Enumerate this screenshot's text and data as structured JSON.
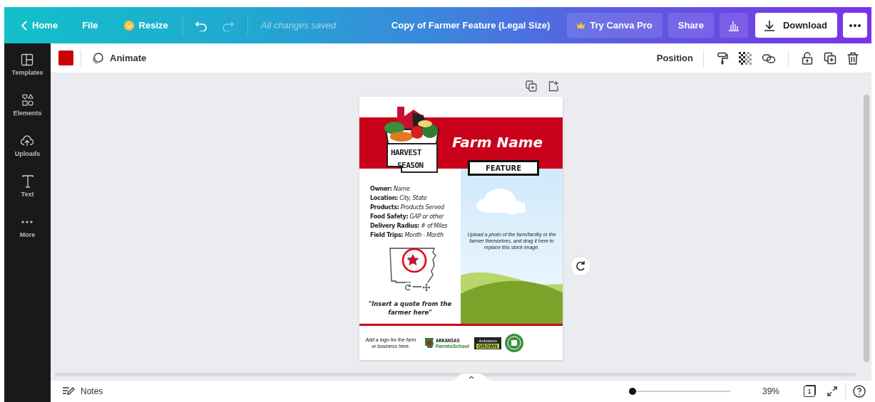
{
  "topbar": {
    "home": "Home",
    "file": "File",
    "resize": "Resize",
    "save_status": "All changes saved",
    "title": "Copy of Farmer Feature (Legal Size)",
    "pro": "Try Canva Pro",
    "share": "Share",
    "download": "Download"
  },
  "toolbar": {
    "color": "#cc0000",
    "animate": "Animate",
    "position": "Position"
  },
  "sidebar": [
    {
      "kind": "templates",
      "label": "Templates"
    },
    {
      "kind": "elements",
      "label": "Elements"
    },
    {
      "kind": "uploads",
      "label": "Uploads"
    },
    {
      "kind": "text",
      "label": "Text"
    },
    {
      "kind": "more",
      "label": "More"
    }
  ],
  "poster": {
    "farm_name": "Farm Name",
    "badge": "FEATURE",
    "logo": {
      "top": "HARVEST",
      "bottom": "SEASON"
    },
    "fields": [
      {
        "label": "Owner:",
        "value": "Name"
      },
      {
        "label": "Location:",
        "value": "City, State"
      },
      {
        "label": "Products:",
        "value": "Products Served"
      },
      {
        "label": "Food Safety:",
        "value": "GAP or other"
      },
      {
        "label": "Delivery Radius:",
        "value": "# of Miles"
      },
      {
        "label": "Field Trips:",
        "value": "Month - Month"
      }
    ],
    "quote": "\"Insert a quote from the farmer here\"",
    "photo_caption": "Upload a photo of the farm/facility or the farmer themselves, and drag it here to replace this stock image.",
    "logo_caption": "Add a logo for the farm or business here.",
    "partner_logos": [
      {
        "kind": "farm-to-school",
        "line1": "ARKANSAS",
        "line2": "FarmtoSchool"
      },
      {
        "kind": "grown",
        "line1": "Arkansas",
        "line2": "GROWN"
      },
      {
        "kind": "seal"
      }
    ]
  },
  "bottombar": {
    "notes": "Notes",
    "zoom": {
      "level": 0.02,
      "reading": "39%"
    },
    "page_count": "1"
  }
}
